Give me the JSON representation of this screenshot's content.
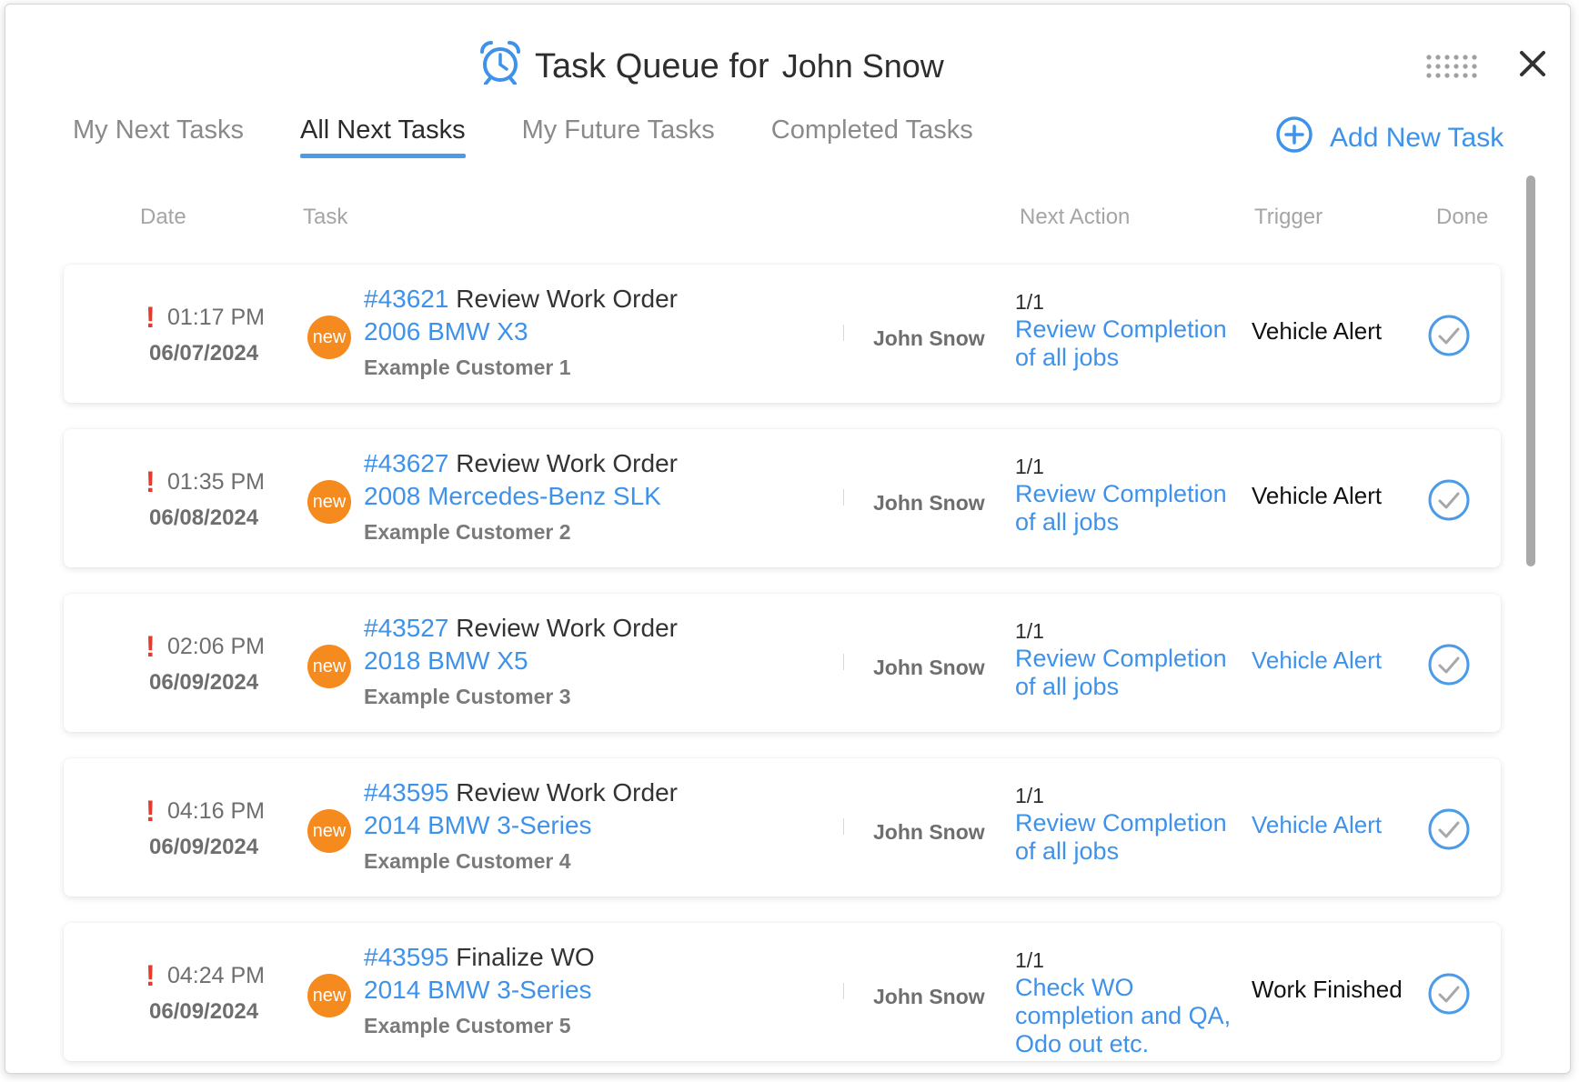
{
  "header": {
    "title_prefix": "Task Queue for",
    "user_name": "John Snow"
  },
  "tabs": [
    {
      "label": "My Next Tasks",
      "active": false
    },
    {
      "label": "All Next Tasks",
      "active": true
    },
    {
      "label": "My Future Tasks",
      "active": false
    },
    {
      "label": "Completed Tasks",
      "active": false
    }
  ],
  "add_task_label": "Add New Task",
  "columns": {
    "date": "Date",
    "task": "Task",
    "next_action": "Next Action",
    "trigger": "Trigger",
    "done": "Done"
  },
  "colors": {
    "accent": "#3f92ea",
    "badge": "#f58a1f",
    "alert": "#e53b2c"
  },
  "tasks": [
    {
      "time": "01:17 PM",
      "date": "06/07/2024",
      "badge": "new",
      "wo": "#43621",
      "title": "Review Work Order",
      "vehicle": "2006 BMW X3",
      "customer": "Example Customer 1",
      "assignee": "John Snow",
      "count": "1/1",
      "action": "Review Completion of all jobs",
      "trigger": "Vehicle Alert",
      "trigger_link": false
    },
    {
      "time": "01:35 PM",
      "date": "06/08/2024",
      "badge": "new",
      "wo": "#43627",
      "title": "Review Work Order",
      "vehicle": "2008 Mercedes-Benz SLK",
      "customer": "Example Customer 2",
      "assignee": "John Snow",
      "count": "1/1",
      "action": "Review Completion of all jobs",
      "trigger": "Vehicle Alert",
      "trigger_link": false
    },
    {
      "time": "02:06 PM",
      "date": "06/09/2024",
      "badge": "new",
      "wo": "#43527",
      "title": "Review Work Order",
      "vehicle": "2018 BMW X5",
      "customer": "Example Customer 3",
      "assignee": "John Snow",
      "count": "1/1",
      "action": "Review Completion of all jobs",
      "trigger": "Vehicle Alert",
      "trigger_link": true
    },
    {
      "time": "04:16 PM",
      "date": "06/09/2024",
      "badge": "new",
      "wo": "#43595",
      "title": "Review Work Order",
      "vehicle": "2014 BMW 3-Series",
      "customer": "Example Customer 4",
      "assignee": "John Snow",
      "count": "1/1",
      "action": "Review Completion of all jobs",
      "trigger": "Vehicle Alert",
      "trigger_link": true
    },
    {
      "time": "04:24 PM",
      "date": "06/09/2024",
      "badge": "new",
      "wo": "#43595",
      "title": "Finalize WO",
      "vehicle": "2014 BMW 3-Series",
      "customer": "Example Customer 5",
      "assignee": "John Snow",
      "count": "1/1",
      "action": "Check WO completion and QA, Odo out etc.",
      "trigger": "Work Finished",
      "trigger_link": false
    }
  ]
}
